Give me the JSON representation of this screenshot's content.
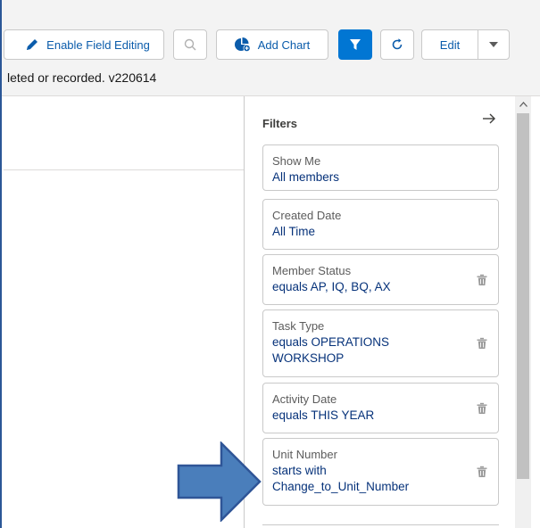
{
  "toolbar": {
    "enable_field_editing": "Enable Field Editing",
    "add_chart": "Add Chart",
    "edit": "Edit"
  },
  "status_text": "leted or recorded. v220614",
  "filters": {
    "title": "Filters",
    "items": [
      {
        "label": "Show Me",
        "value": "All members",
        "removable": false
      },
      {
        "label": "Created Date",
        "value": "All Time",
        "removable": false
      },
      {
        "label": "Member Status",
        "value": "equals AP, IQ, BQ, AX",
        "removable": true
      },
      {
        "label": "Task Type",
        "value": "equals OPERATIONS WORKSHOP",
        "removable": true
      },
      {
        "label": "Activity Date",
        "value": "equals THIS YEAR",
        "removable": true
      },
      {
        "label": "Unit Number",
        "value": "starts with Change_to_Unit_Number",
        "removable": true
      }
    ]
  },
  "colors": {
    "brand_blue": "#0176d3",
    "link_blue": "#0b5cab",
    "value_blue": "#06327a",
    "arrow_fill": "#4a7ebb",
    "arrow_stroke": "#2f5597"
  },
  "icons": [
    "pencil-icon",
    "search-icon",
    "add-chart-icon",
    "filter-icon",
    "refresh-icon",
    "chevron-down-icon",
    "arrow-right-icon",
    "trash-icon"
  ]
}
